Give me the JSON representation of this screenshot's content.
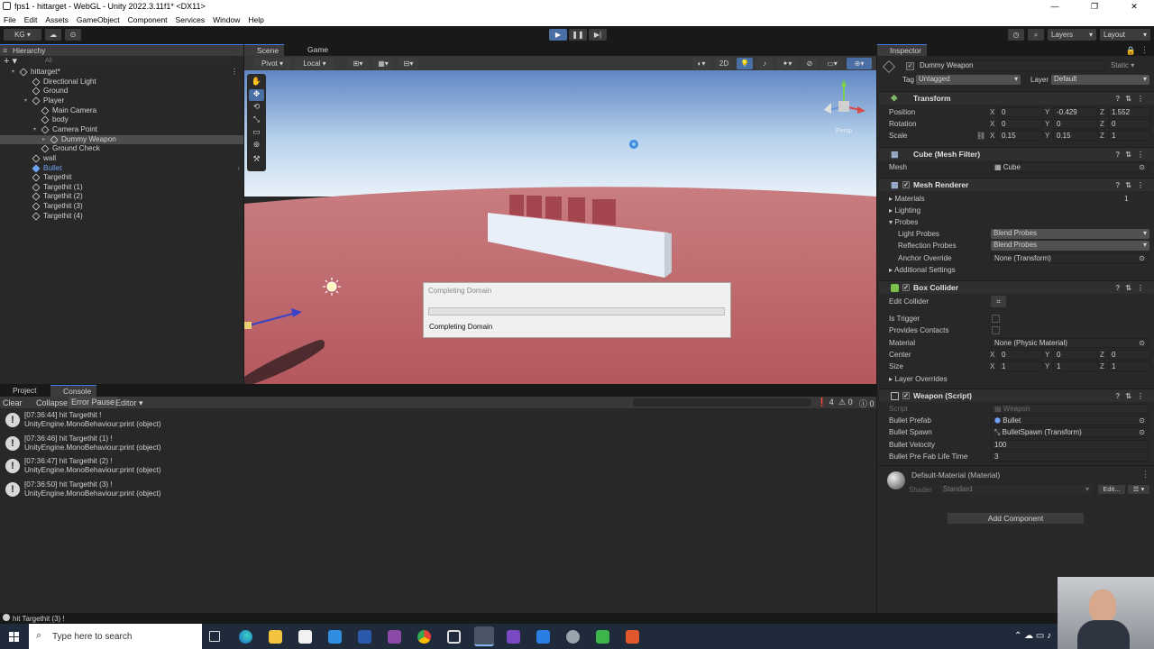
{
  "window": {
    "title": "fps1 - hittarget - WebGL - Unity 2022.3.11f1* <DX11>",
    "controls": [
      "—",
      "❐",
      "✕"
    ]
  },
  "menu": [
    "File",
    "Edit",
    "Assets",
    "GameObject",
    "Component",
    "Services",
    "Window",
    "Help"
  ],
  "toolbar": {
    "account": "KG",
    "layers": "Layers",
    "layout": "Layout"
  },
  "hierarchy": {
    "tab": "Hierarchy",
    "search_placeholder": "All",
    "items": [
      {
        "label": "hittarget*",
        "depth": 0
      },
      {
        "label": "Directional Light",
        "depth": 1
      },
      {
        "label": "Ground",
        "depth": 1
      },
      {
        "label": "Player",
        "depth": 1
      },
      {
        "label": "Main Camera",
        "depth": 2
      },
      {
        "label": "body",
        "depth": 2
      },
      {
        "label": "Camera Point",
        "depth": 2
      },
      {
        "label": "Dummy Weapon",
        "depth": 3
      },
      {
        "label": "Ground Check",
        "depth": 2
      },
      {
        "label": "wall",
        "depth": 1
      },
      {
        "label": "Bullet",
        "depth": 1
      },
      {
        "label": "Targethit",
        "depth": 1
      },
      {
        "label": "Targethit (1)",
        "depth": 1
      },
      {
        "label": "Targethit (2)",
        "depth": 1
      },
      {
        "label": "Targethit (3)",
        "depth": 1
      },
      {
        "label": "Targethit (4)",
        "depth": 1
      }
    ]
  },
  "scene": {
    "tabs": [
      "Scene",
      "Game"
    ],
    "pivot": "Pivot",
    "local": "Local",
    "mode_2d": "2D",
    "gizmo_label": "Persp"
  },
  "dialog": {
    "title": "Completing Domain",
    "message": "Completing Domain",
    "progress": 0
  },
  "console": {
    "tabs": [
      "Project",
      "Console"
    ],
    "buttons": [
      "Clear",
      "Collapse",
      "Error Pause",
      "Editor"
    ],
    "counts": {
      "warnings": "4",
      "errors": "0",
      "infos": "0"
    },
    "entries": [
      {
        "line1": "[07:36:44] hit Targethit !",
        "line2": "UnityEngine.MonoBehaviour:print (object)"
      },
      {
        "line1": "[07:36:46] hit Targethit (1) !",
        "line2": "UnityEngine.MonoBehaviour:print (object)"
      },
      {
        "line1": "[07:36:47] hit Targethit (2) !",
        "line2": "UnityEngine.MonoBehaviour:print (object)"
      },
      {
        "line1": "[07:36:50] hit Targethit (3) !",
        "line2": "UnityEngine.MonoBehaviour:print (object)"
      }
    ],
    "status": "hit Targethit (3) !"
  },
  "inspector": {
    "tab": "Inspector",
    "object_name": "Dummy Weapon",
    "static": "Static",
    "tag_label": "Tag",
    "tag": "Untagged",
    "layer_label": "Layer",
    "layer": "Default",
    "transform": {
      "title": "Transform",
      "position": {
        "label": "Position",
        "x": "0",
        "y": "-0.429",
        "z": "1.552"
      },
      "rotation": {
        "label": "Rotation",
        "x": "0",
        "y": "0",
        "z": "0"
      },
      "scale": {
        "label": "Scale",
        "x": "0.15",
        "y": "0.15",
        "z": "1"
      }
    },
    "mesh_filter": {
      "title": "Cube (Mesh Filter)",
      "mesh_label": "Mesh",
      "mesh": "Cube"
    },
    "mesh_renderer": {
      "title": "Mesh Renderer",
      "materials": "Materials",
      "materials_count": "1",
      "lighting": "Lighting",
      "probes": "Probes",
      "light_probes_label": "Light Probes",
      "light_probes": "Blend Probes",
      "reflection_probes_label": "Reflection Probes",
      "reflection_probes": "Blend Probes",
      "anchor_label": "Anchor Override",
      "anchor": "None (Transform)",
      "additional": "Additional Settings"
    },
    "box_collider": {
      "title": "Box Collider",
      "edit_collider": "Edit Collider",
      "is_trigger": "Is Trigger",
      "provides_contacts": "Provides Contacts",
      "material_label": "Material",
      "material": "None (Physic Material)",
      "center": {
        "label": "Center",
        "x": "0",
        "y": "0",
        "z": "0"
      },
      "size": {
        "label": "Size",
        "x": "1",
        "y": "1",
        "z": "1"
      },
      "layer_overrides": "Layer Overrides"
    },
    "weapon": {
      "title": "Weapon (Script)",
      "script_label": "Script",
      "script": "Weapon",
      "prefab_label": "Bullet Prefab",
      "prefab": "Bullet",
      "spawn_label": "Bullet Spawn",
      "spawn": "BulletSpawn (Transform)",
      "velocity_label": "Bullet Velocity",
      "velocity": "100",
      "lifetime_label": "Bullet Pre Fab Life Time",
      "lifetime": "3"
    },
    "material": {
      "title": "Default-Material (Material)",
      "shader_label": "Shader",
      "shader": "Standard",
      "edit": "Edit..."
    },
    "add_component": "Add Component"
  },
  "taskbar": {
    "search_placeholder": "Type here to search"
  }
}
